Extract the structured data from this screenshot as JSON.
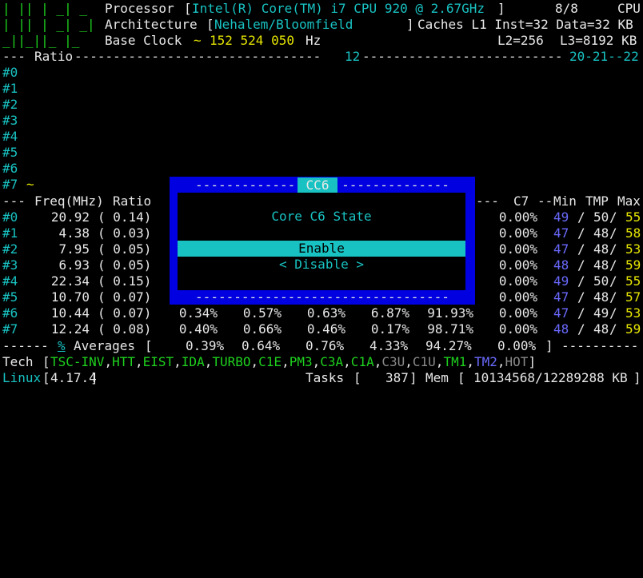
{
  "header": {
    "logo_lines": [
      "| || | _| _",
      "| || | _| _|",
      "_||_||_ |_"
    ],
    "processor_label": "Processor",
    "processor_value": "Intel(R) Core(TM) i7 CPU 920 @ 2.67GHz",
    "cpu_count": "8/8",
    "cpu_label": "CPU",
    "arch_label": "Architecture",
    "arch_value": "Nehalem/Bloomfield",
    "caches": "Caches L1 Inst=32 Data=32 KB",
    "base_clock_label": "Base Clock",
    "base_clock_value": "152 524 050",
    "base_clock_unit": "Hz",
    "l2": "L2=256",
    "l3": "L3=8192 KB"
  },
  "ratio_bar": {
    "label": "Ratio",
    "mark_12": "12",
    "mark_20_22": "20-21--22"
  },
  "core_ids": [
    "#0",
    "#1",
    "#2",
    "#3",
    "#4",
    "#5",
    "#6",
    "#7"
  ],
  "core7_tilde": "~",
  "table_header": {
    "freq": "Freq(MHz)",
    "ratio": "Ratio",
    "c7": "C7",
    "min": "Min",
    "tmp": "TMP",
    "max": "Max"
  },
  "cores": [
    {
      "id": "#0",
      "freq": "20.92",
      "ratio": "( 0.14)",
      "c7": "0.00%",
      "min": "49",
      "tmp": "50",
      "max": "55"
    },
    {
      "id": "#1",
      "freq": "4.38",
      "ratio": "( 0.03)",
      "c7": "0.00%",
      "min": "47",
      "tmp": "48",
      "max": "58"
    },
    {
      "id": "#2",
      "freq": "7.95",
      "ratio": "( 0.05)",
      "c7": "0.00%",
      "min": "47",
      "tmp": "48",
      "max": "53"
    },
    {
      "id": "#3",
      "freq": "6.93",
      "ratio": "( 0.05)",
      "c7": "0.00%",
      "min": "48",
      "tmp": "48",
      "max": "59"
    },
    {
      "id": "#4",
      "freq": "22.34",
      "ratio": "( 0.15)",
      "c7": "0.00%",
      "min": "49",
      "tmp": "50",
      "max": "55"
    },
    {
      "id": "#5",
      "freq": "10.70",
      "ratio": "( 0.07)",
      "c7": "0.00%",
      "min": "47",
      "tmp": "48",
      "max": "57"
    },
    {
      "id": "#6",
      "freq": "10.44",
      "ratio": "( 0.07)",
      "c1": "0.34%",
      "c3": "0.57%",
      "c6a": "0.63%",
      "c6b": "6.87%",
      "c6c": "91.93%",
      "c7": "0.00%",
      "min": "47",
      "tmp": "49",
      "max": "53"
    },
    {
      "id": "#7",
      "freq": "12.24",
      "ratio": "( 0.08)",
      "c1": "0.40%",
      "c3": "0.66%",
      "c6a": "0.46%",
      "c6b": "0.17%",
      "c6c": "98.71%",
      "c7": "0.00%",
      "min": "48",
      "tmp": "48",
      "max": "59"
    }
  ],
  "averages": {
    "pct": "%",
    "label": "Averages",
    "v1": "0.39%",
    "v2": "0.64%",
    "v3": "0.76%",
    "v4": "4.33%",
    "v5": "94.27%",
    "v6": "0.00%"
  },
  "tech": {
    "label": "Tech",
    "items": [
      {
        "t": "TSC-INV",
        "c": "gr"
      },
      {
        "t": "HTT",
        "c": "gr"
      },
      {
        "t": "EIST",
        "c": "gr"
      },
      {
        "t": "IDA",
        "c": "gr"
      },
      {
        "t": "TURBO",
        "c": "gr"
      },
      {
        "t": "C1E",
        "c": "gr"
      },
      {
        "t": "PM3",
        "c": "gr"
      },
      {
        "t": "C3A",
        "c": "gr"
      },
      {
        "t": "C1A",
        "c": "gr"
      },
      {
        "t": "C3U",
        "c": "gy"
      },
      {
        "t": "C1U",
        "c": "gy"
      },
      {
        "t": "TM1",
        "c": "gr"
      },
      {
        "t": "TM2",
        "c": "bl"
      },
      {
        "t": "HOT",
        "c": "gy"
      }
    ]
  },
  "footer": {
    "os": "Linux",
    "kernel": "4.17.4",
    "tasks_label": "Tasks",
    "tasks_value": "387",
    "mem_label": "Mem",
    "mem_value": "10134568/12289288 KB"
  },
  "dialog": {
    "title": "CC6",
    "subtitle": "Core C6 State",
    "option_enable": "Enable",
    "option_disable": "< Disable >"
  }
}
